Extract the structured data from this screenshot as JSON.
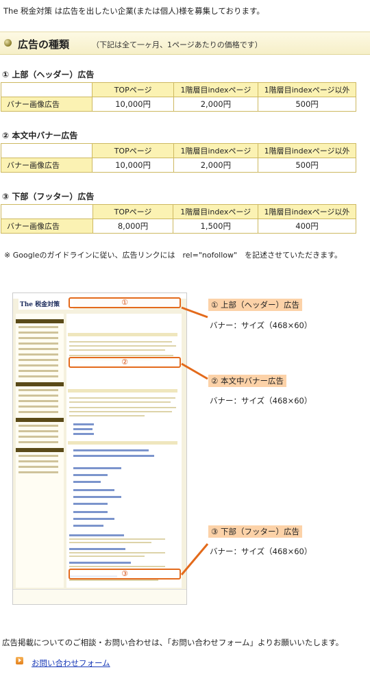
{
  "intro": "The 税金対策 は広告を出したい企業(または個人)様を募集しております。",
  "section": {
    "title": "広告の種類",
    "note": "（下記は全て一ヶ月、1ページあたりの価格です）"
  },
  "columns": [
    "TOPページ",
    "1階層目indexページ",
    "1階層目indexページ以外"
  ],
  "tables": [
    {
      "title": "① 上部（ヘッダー）広告",
      "row_label": "バナー画像広告",
      "prices": [
        "10,000円",
        "2,000円",
        "500円"
      ]
    },
    {
      "title": "② 本文中バナー広告",
      "row_label": "バナー画像広告",
      "prices": [
        "10,000円",
        "2,000円",
        "500円"
      ]
    },
    {
      "title": "③ 下部（フッター）広告",
      "row_label": "バナー画像広告",
      "prices": [
        "8,000円",
        "1,500円",
        "400円"
      ]
    }
  ],
  "note": "※ Googleのガイドラインに従い、広告リンクには　rel=\"nofollow\"　を記述させていただきます。",
  "mock": {
    "logo": "The 税金対策",
    "markers": [
      "①",
      "②",
      "③"
    ]
  },
  "callouts": [
    {
      "label": "① 上部（ヘッダー）広告",
      "size": "バナー：サイズ（468×60）"
    },
    {
      "label": "② 本文中バナー広告",
      "size": "バナー：サイズ（468×60）"
    },
    {
      "label": "③ 下部（フッター）広告",
      "size": "バナー：サイズ（468×60）"
    }
  ],
  "contact_text": "広告掲載についてのご相談・お問い合わせは、「お問い合わせフォーム」よりお願いいたします。",
  "contact_link": "お問い合わせフォーム",
  "colors": {
    "accent": "#e36a1b",
    "header_bg": "#fbf2b3",
    "link": "#1a3bb8"
  }
}
